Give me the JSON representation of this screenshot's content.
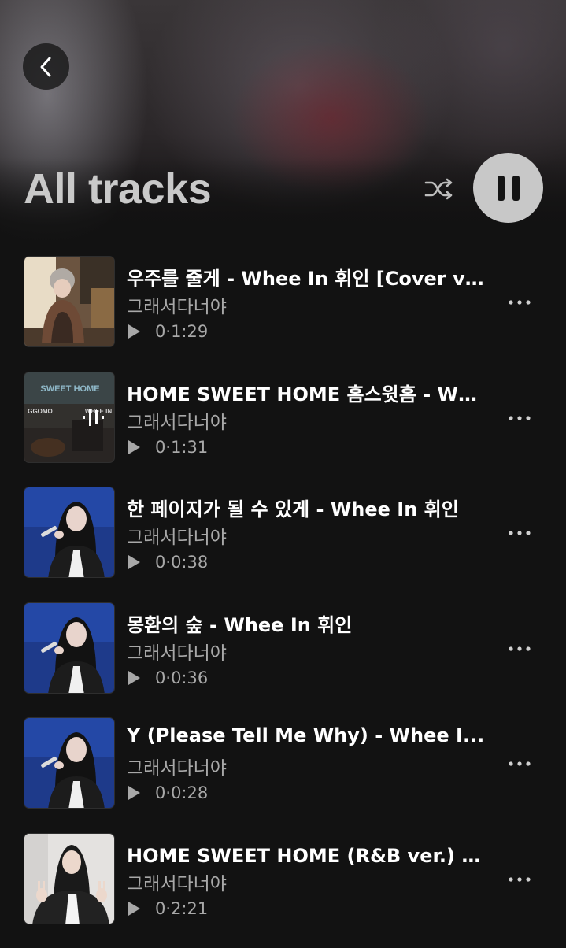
{
  "header": {
    "title": "All tracks",
    "back_icon": "chevron-left-icon",
    "shuffle_icon": "shuffle-icon",
    "pause_icon": "pause-icon"
  },
  "colors": {
    "background": "#121212",
    "title": "#c9c9c9",
    "secondary_text": "#a8a8a8",
    "pause_button": "#c8c8c8"
  },
  "tracks": [
    {
      "title": "우주를 줄게 - Whee In 휘인 [Cover ver.]",
      "artist": "그래서다너야",
      "plays": "0",
      "duration": "1:29",
      "playing": false
    },
    {
      "title": "HOME SWEET HOME 홈스윗홈 - Wh...",
      "artist": "그래서다너야",
      "plays": "0",
      "duration": "1:31",
      "playing": true,
      "thumb_text_top": "SWEET HOME",
      "thumb_text_left": "GGOMO",
      "thumb_text_right": "WHEE IN"
    },
    {
      "title": "한 페이지가 될 수 있게 - Whee In 휘인",
      "artist": "그래서다너야",
      "plays": "0",
      "duration": "0:38",
      "playing": false
    },
    {
      "title": "몽환의 숲 - Whee In 휘인",
      "artist": "그래서다너야",
      "plays": "0",
      "duration": "0:36",
      "playing": false
    },
    {
      "title": "Y (Please Tell Me Why) - Whee I...",
      "artist": "그래서다너야",
      "plays": "0",
      "duration": "0:28",
      "playing": false
    },
    {
      "title": "HOME SWEET HOME (R&B ver.) 홈…",
      "artist": "그래서다너야",
      "plays": "0",
      "duration": "2:21",
      "playing": false
    }
  ]
}
